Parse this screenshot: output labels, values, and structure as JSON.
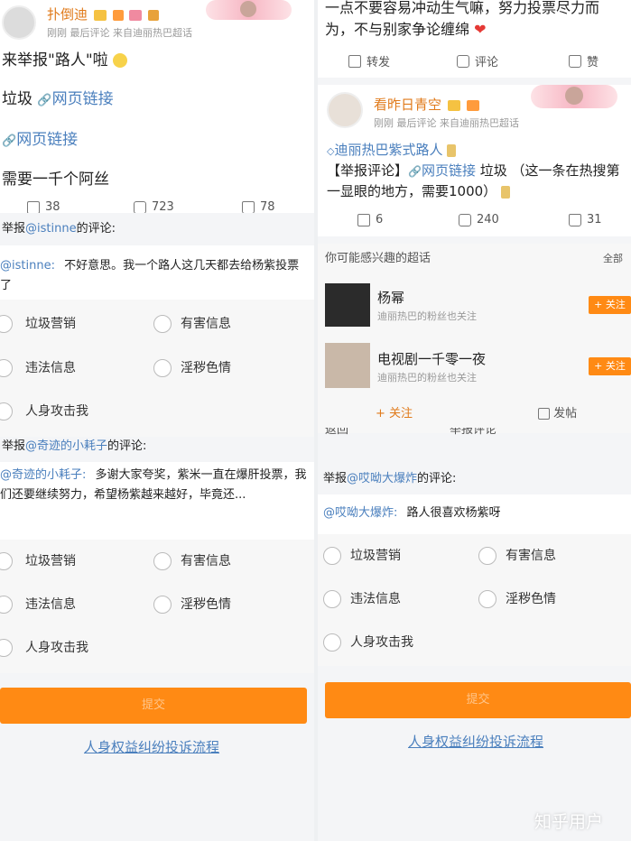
{
  "left": {
    "post": {
      "username": "扑倒迪",
      "meta": "刚刚 最后评论  来自迪丽热巴超话",
      "line1": "来举报\"路人\"啦",
      "line2_text": "垃圾",
      "link_label": "网页链接",
      "line3_link": "网页链接",
      "line4": "需要一千个阿丝",
      "actions": [
        "38",
        "723",
        "78"
      ]
    },
    "report1": {
      "title_prefix": "举报",
      "title_user": "@istinne",
      "title_suffix": "的评论:",
      "quote_user": "@istinne:",
      "quote_text": "不好意思。我一个路人这几天都去给杨紫投票了",
      "options": [
        "垃圾营销",
        "有害信息",
        "违法信息",
        "淫秽色情",
        "人身攻击我"
      ]
    },
    "report2": {
      "title_prefix": "举报",
      "title_user": "@奇迹的小耗子",
      "title_suffix": "的评论:",
      "quote_user": "@奇迹的小耗子:",
      "quote_text": "多谢大家夸奖，紫米一直在爆肝投票，我们还要继续努力，希望杨紫越来越好，毕竟还...",
      "options": [
        "垃圾营销",
        "有害信息",
        "违法信息",
        "淫秽色情",
        "人身攻击我"
      ]
    },
    "submit_label": "提交",
    "footer_link": "人身权益纠纷投诉流程"
  },
  "right": {
    "top_text": "一点不要容易冲动生气嘛，努力投票尽力而为，不与别家争论缠绵",
    "top_actions": [
      "转发",
      "评论",
      "赞"
    ],
    "post2": {
      "username": "看昨日青空",
      "meta": "刚刚 最后评论  来自迪丽热巴超话",
      "line1": "迪丽热巴紫式路人",
      "line2_prefix": "【举报评论】",
      "link_label": "网页链接",
      "line2_suffix": "垃圾 （这一条在热搜第一显眼的地方，需要1000）",
      "actions": [
        "6",
        "240",
        "31"
      ]
    },
    "suggest": {
      "header": "你可能感兴趣的超话",
      "all_label": "全部",
      "items": [
        {
          "name": "杨幂",
          "sub": "迪丽热巴的粉丝也关注",
          "follow": "+ 关注"
        },
        {
          "name": "电视剧一千零一夜",
          "sub": "迪丽热巴的粉丝也关注",
          "follow": "+ 关注"
        }
      ],
      "bottom_follow": "+ 关注",
      "bottom_post": "发帖"
    },
    "overlay_nav": [
      "返回",
      "举报评论"
    ],
    "report3": {
      "title_prefix": "举报",
      "title_user": "@哎呦大爆炸",
      "title_suffix": "的评论:",
      "quote_user": "@哎呦大爆炸:",
      "quote_text": "路人很喜欢杨紫呀",
      "options": [
        "垃圾营销",
        "有害信息",
        "违法信息",
        "淫秽色情",
        "人身攻击我"
      ]
    },
    "submit_label": "提交",
    "footer_link": "人身权益纠纷投诉流程"
  },
  "watermark": "知乎用户",
  "colors": {
    "accent": "#ff8a14",
    "link": "#4a7fbd"
  }
}
